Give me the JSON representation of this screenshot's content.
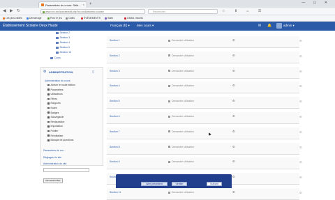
{
  "browser": {
    "tab_title": "Paramètres du cours: Sélé...",
    "tab_close": "×",
    "new_tab": "+",
    "window_controls": "— ▢ ✕",
    "back": "◀",
    "forward": "▶",
    "reload": "↻",
    "url": "www.xxx.xxx/course/edit.php?id=xxx&returnto=course",
    "search_placeholder": "Rechercher",
    "toolbar_icons": "☆ ⬇ ⌂ ☰",
    "bookmarks": [
      {
        "label": "Les plus visités",
        "color": "#e8761d"
      },
      {
        "label": "Démarrage",
        "color": "#3b7ddd"
      },
      {
        "label": "Pour le jeu",
        "color": "#5b9f3b"
      },
      {
        "label": "Outils",
        "color": "#888888"
      },
      {
        "label": "ÉVÉNEMENTS",
        "color": "#d23c3c"
      },
      {
        "label": "Stats",
        "color": "#7a5bbf"
      },
      {
        "label": "GMAIL Inscrits",
        "color": "#c23"
      }
    ]
  },
  "header": {
    "site_title": "Établissement Scolaire Deux Haute",
    "nav_menu_1": "Français (fr) ▾",
    "nav_menu_2": "Mes cours ▾",
    "user_name": "admin ▾",
    "icon_msg": "✉",
    "icon_notif": "🔔"
  },
  "tree": [
    {
      "label": "Section 2"
    },
    {
      "label": "Section 3"
    },
    {
      "label": "Section 4"
    },
    {
      "label": "Section 5"
    },
    {
      "label": "Section 13"
    },
    {
      "label": "Cours"
    }
  ],
  "admin_block": {
    "title": "ADMINISTRATION",
    "collapse": "◻",
    "section_label": "Administration du cours",
    "items": [
      "Activer le mode édition",
      "Paramètres",
      "Utilisateurs",
      "Filtres",
      "Rapports",
      "Notes",
      "Badges",
      "Sauvegarde",
      "Restauration",
      "Importation",
      "Publier",
      "Réinitialiser",
      "Banque de questions"
    ],
    "link_1": "Paramètres de mo...",
    "link_2": "Réglages du site",
    "link_3": "Administration du site",
    "search_button": "RECHERCHER"
  },
  "sections": [
    {
      "name": "Section 1",
      "status": "Demander utilisateur",
      "edit": "⚙"
    },
    {
      "name": "Section 2",
      "status": "Demander utilisateur",
      "edit": "⚙"
    },
    {
      "name": "Section 3",
      "status": "Demander utilisateur",
      "edit": "⚙"
    },
    {
      "name": "Section 4",
      "status": "Demander utilisateur",
      "edit": "⚙"
    },
    {
      "name": "Section 5",
      "status": "Demander utilisateur",
      "edit": "⚙"
    },
    {
      "name": "Section 6",
      "status": "Demander utilisateur",
      "edit": "⚙"
    },
    {
      "name": "Section 7",
      "status": "Demander utilisateur",
      "edit": "⚙"
    },
    {
      "name": "Section 8",
      "status": "Demander utilisateur",
      "edit": "⚙"
    },
    {
      "name": "Section 9",
      "status": "Demander utilisateur",
      "edit": "⚙"
    },
    {
      "name": "Section 10",
      "status": "Demander utilisateur",
      "edit": "⚙"
    },
    {
      "name": "Section 11",
      "status": "Demander utilisateur",
      "edit": "⚙"
    }
  ],
  "right_icon": "⚙",
  "footer_buttons": {
    "prev": "Aller précédent",
    "view": "Vérifier",
    "save": "Suivant"
  }
}
